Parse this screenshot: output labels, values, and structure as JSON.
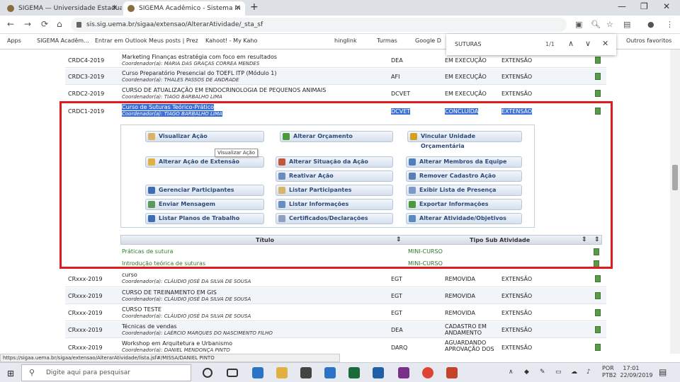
{
  "browser": {
    "tabs": [
      {
        "label": "SIGEMA — Universidade Estadual d",
        "active": false
      },
      {
        "label": "SIGEMA Acadêmico - Sistema In",
        "active": true
      }
    ],
    "new_tab": "+",
    "window_controls": [
      "—",
      "❐",
      "✕"
    ],
    "url": "sis.sig.uema.br/sigaa/extensao/AlterarAtividade/_sta_sf",
    "bookmarks": [
      "Apps",
      "SIGEMA Acadêm...",
      "Entrar em Outlook",
      "Meus posts | Prez",
      "Kahoot! - My Kaho",
      "hinglink",
      "Turmas",
      "Google D",
      "Outros favoritos"
    ]
  },
  "find": {
    "query": "SUTURAS",
    "count": "1/1"
  },
  "rows_top": [
    {
      "code": "CRDC4-2019",
      "title": "Marketing Finanças estratégia com foco em resultados",
      "coord": "Coordenador(a): MARIA DAS GRAÇAS CORREA MENDES",
      "unit": "DEA",
      "status": "EM EXECUÇÃO",
      "mod": "EXTENSÃO"
    },
    {
      "code": "CRDC3-2019",
      "title": "Curso Preparatório Presencial do TOEFL ITP (Módulo 1)",
      "coord": "Coordenador(a): THALES PASSOS DE ANDRADE",
      "unit": "AFI",
      "status": "EM EXECUÇÃO",
      "mod": "EXTENSÃO"
    },
    {
      "code": "CRDC2-2019",
      "title": "CURSO DE ATUALIZAÇÃO EM ENDOCRINOLOGIA DE PEQUENOS ANIMAIS",
      "coord": "Coordenador(a): TIAGO BARBALHO LIMA",
      "unit": "DCVET",
      "status": "EM EXECUÇÃO",
      "mod": "EXTENSÃO"
    }
  ],
  "selected_row": {
    "code": "CRDC1-2019",
    "title": "Curso de Suturas Teórico-Prático",
    "coord": "Coordenador(a): TIAGO BARBALHO LIMA",
    "unit": "DCVET",
    "status": "CONCLUÍDA",
    "mod": "EXTENSÃO"
  },
  "actions": {
    "visualizar": "Visualizar Ação",
    "orcamento": "Alterar Orçamento",
    "vincular1": "Vincular Unidade",
    "vincular2": "Orçamentária",
    "alterar_acao": "Alterar Ação de Extensão",
    "situacao": "Alterar Situação da Ação",
    "membros": "Alterar Membros da Equipe",
    "reativar": "Reativar Ação",
    "remover": "Remover Cadastro Ação",
    "participantes": "Gerenciar Participantes",
    "listar_part": "Listar Participantes",
    "presenca": "Exibir Lista de Presença",
    "mensagem": "Enviar Mensagem",
    "info": "Listar Informações",
    "exportar": "Exportar Informações",
    "planos": "Listar Planos de Trabalho",
    "certificados": "Certificados/Declarações",
    "atividades": "Alterar Atividade/Objetivos"
  },
  "tooltip": "Visualizar Ação",
  "subtable": {
    "col_title": "Título",
    "col_type": "Tipo Sub Atividade",
    "rows": [
      {
        "title": "Práticas de sutura",
        "type": "MINI-CURSO"
      },
      {
        "title": "Introdução teórica de suturas",
        "type": "MINI-CURSO"
      }
    ]
  },
  "rows_bottom": [
    {
      "code": "CRxxx-2019",
      "title": "curso",
      "coord": "Coordenador(a): CLÁUDIO JOSÉ DA SILVA DE SOUSA",
      "unit": "EGT",
      "status": "REMOVIDA",
      "mod": "EXTENSÃO"
    },
    {
      "code": "CRxxx-2019",
      "title": "CURSO DE TREINAMENTO EM GIS",
      "coord": "Coordenador(a): CLÁUDIO JOSÉ DA SILVA DE SOUSA",
      "unit": "EGT",
      "status": "REMOVIDA",
      "mod": "EXTENSÃO"
    },
    {
      "code": "CRxxx-2019",
      "title": "CURSO TESTE",
      "coord": "Coordenador(a): CLÁUDIO JOSÉ DA SILVA DE SOUSA",
      "unit": "EGT",
      "status": "REMOVIDA",
      "mod": "EXTENSÃO"
    },
    {
      "code": "CRxxx-2019",
      "title": "Técnicas de vendas",
      "coord": "Coordenador(a): LAÉRCIO MARQUES DO NASCIMENTO FILHO",
      "unit": "DEA",
      "status": "CADASTRO EM ANDAMENTO",
      "mod": "EXTENSÃO"
    },
    {
      "code": "CRxxx-2019",
      "title": "Workshop em Arquitetura e Urbanismo",
      "coord": "Coordenador(a): DANIEL MENDONÇA PINTO",
      "unit": "DARQ",
      "status": "AGUARDANDO APROVAÇÃO DOS",
      "mod": "EXTENSÃO"
    }
  ],
  "status_url": "https://sigaa.uema.br/sigaa/extensao/AlterarAtividade/lista.jsf#/MISSA/DANIEL PINTO",
  "taskbar": {
    "search_placeholder": "Digite aqui para pesquisar",
    "lang": "POR",
    "locale": "PTB2",
    "time": "17:01",
    "date": "22/09/2019"
  }
}
